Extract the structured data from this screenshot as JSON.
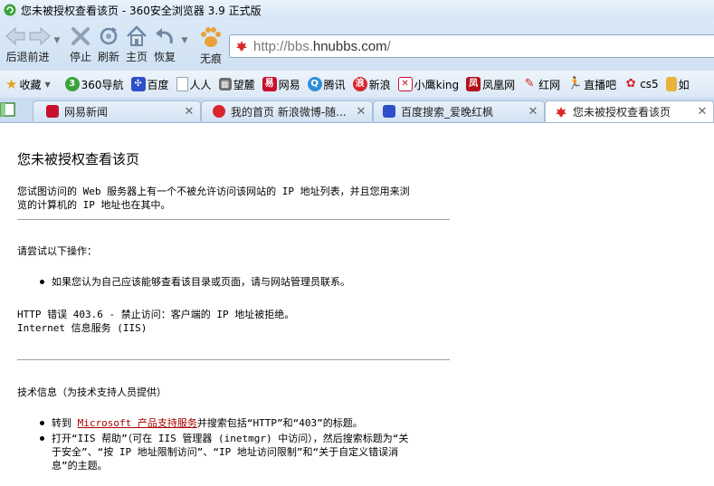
{
  "window": {
    "title": "您未被授权查看该页 - 360安全浏览器 3.9 正式版"
  },
  "nav": {
    "back_forward_label": "后退前进",
    "stop_label": "停止",
    "refresh_label": "刷新",
    "home_label": "主页",
    "restore_label": "恢复",
    "no_trace_label": "无痕",
    "url_prefix": "http://bbs.",
    "url_domain": "hnubbs.com",
    "url_suffix": "/"
  },
  "favorites": {
    "items": [
      {
        "label": "收藏",
        "icon": "star-icon",
        "color": "#e8a317"
      },
      {
        "label": "360导航",
        "icon": "360-icon",
        "color": "#3aa33a"
      },
      {
        "label": "百度",
        "icon": "baidu-icon",
        "color": "#2d4fc7"
      },
      {
        "label": "人人",
        "icon": "page-icon",
        "color": "#9aa4b0"
      },
      {
        "label": "望麓",
        "icon": "site-icon",
        "color": "#6d6d6d"
      },
      {
        "label": "网易",
        "icon": "netease-icon",
        "color": "#c8102e"
      },
      {
        "label": "腾讯",
        "icon": "tencent-icon",
        "color": "#2f8fd8"
      },
      {
        "label": "新浪",
        "icon": "sina-icon",
        "color": "#d9262c"
      },
      {
        "label": "小鹰king",
        "icon": "eagle-icon",
        "color": "#c8102e"
      },
      {
        "label": "凤凰网",
        "icon": "ifeng-icon",
        "color": "#b5121b"
      },
      {
        "label": "红网",
        "icon": "rednet-icon",
        "color": "#d62020"
      },
      {
        "label": "直播吧",
        "icon": "zhibo8-icon",
        "color": "#222222"
      },
      {
        "label": "cs5",
        "icon": "cs5-icon",
        "color": "#d62020"
      },
      {
        "label": "如",
        "icon": "folder-icon",
        "color": "#e8b33b"
      }
    ]
  },
  "tabs": [
    {
      "label": "网易新闻",
      "icon": "netease-icon",
      "color": "#c8102e",
      "active": false
    },
    {
      "label": "我的首页 新浪微博-随...",
      "icon": "weibo-icon",
      "color": "#d9262c",
      "active": false
    },
    {
      "label": "百度搜索_爱晚红枫",
      "icon": "baidu-icon",
      "color": "#2d4fc7",
      "active": false
    },
    {
      "label": "您未被授权查看该页",
      "icon": "maple-icon",
      "color": "#d9262c",
      "active": true
    }
  ],
  "page": {
    "title": "您未被授权查看该页",
    "intro_line1": "您试图访问的 Web 服务器上有一个不被允许访问该网站的 IP 地址列表，并且您用来浏",
    "intro_line2": "览的计算机的 IP 地址也在其中。",
    "try_heading": "请尝试以下操作：",
    "try_item1": "如果您认为自己应该能够查看该目录或页面，请与网站管理员联系。",
    "error_line1": "HTTP 错误 403.6 - 禁止访问：客户端的 IP 地址被拒绝。",
    "error_line2": "Internet 信息服务 (IIS)",
    "tech_heading": "技术信息（为技术支持人员提供）",
    "tech_item1_pre": "转到 ",
    "tech_item1_link": "Microsoft 产品支持服务",
    "tech_item1_post": "并搜索包括“HTTP”和“403”的标题。",
    "tech_item2_line1": "打开“IIS 帮助”（可在 IIS 管理器 (inetmgr) 中访问），然后搜索标题为“关",
    "tech_item2_line2": "于安全”、“按 IP 地址限制访问”、“IP 地址访问限制”和“关于自定义错误消",
    "tech_item2_line3": "息”的主题。"
  }
}
